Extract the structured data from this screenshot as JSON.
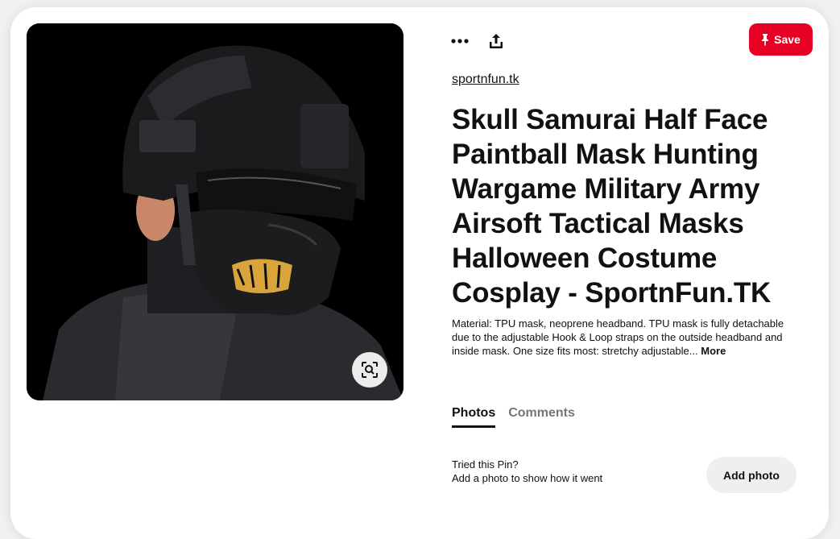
{
  "header": {
    "more_icon": "ellipsis-icon",
    "share_icon": "share-icon",
    "save_label": "Save",
    "save_icon": "pin-icon",
    "save_color": "#e60023"
  },
  "pin": {
    "source": "sportnfun.tk",
    "title": "Skull Samurai Half Face Paintball Mask Hunting Wargame Military Army Airsoft Tactical Masks Halloween Costume Cosplay - SportnFun.TK",
    "description": "Material: TPU mask, neoprene headband. TPU mask is fully detachable due to the adjustable Hook & Loop straps on the outside headband and inside mask. One size fits most: stretchy adjustable...",
    "more_label": "More",
    "lens_icon": "visual-search-icon"
  },
  "tabs": [
    {
      "label": "Photos",
      "active": true
    },
    {
      "label": "Comments",
      "active": false
    }
  ],
  "tried": {
    "line1": "Tried this Pin?",
    "line2": "Add a photo to show how it went",
    "button_label": "Add photo"
  }
}
